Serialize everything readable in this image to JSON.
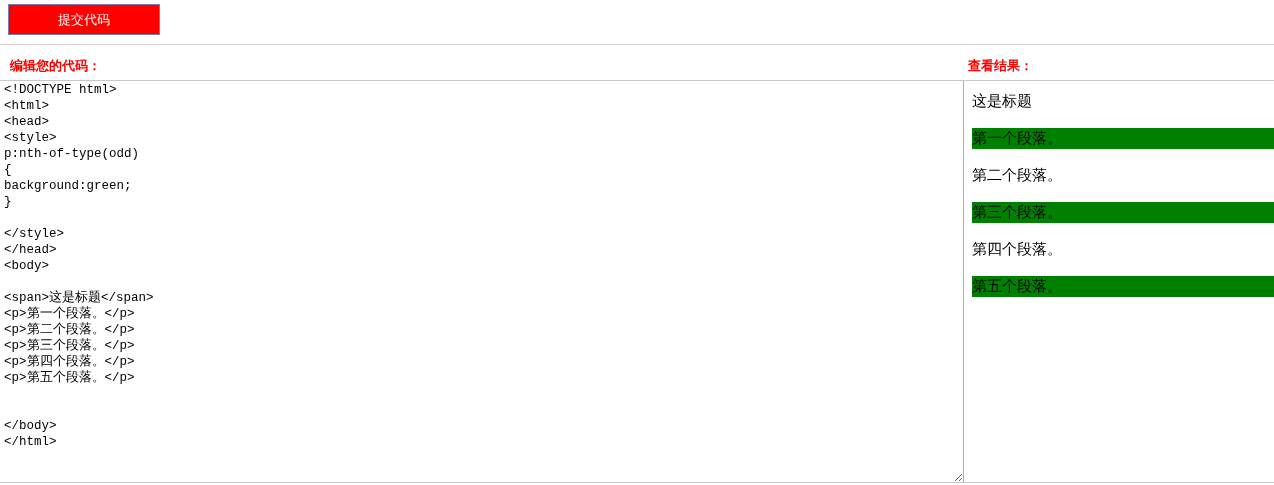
{
  "submit_button": {
    "label": "提交代码"
  },
  "editor": {
    "label": "编辑您的代码：",
    "code": "<!DOCTYPE html>\n<html>\n<head>\n<style>\np:nth-of-type(odd)\n{\nbackground:green;\n}\n\n</style>\n</head>\n<body>\n\n<span>这是标题</span>\n<p>第一个段落。</p>\n<p>第二个段落。</p>\n<p>第三个段落。</p>\n<p>第四个段落。</p>\n<p>第五个段落。</p>\n\n\n</body>\n</html>"
  },
  "result": {
    "label": "查看结果：",
    "title": "这是标题",
    "paragraphs": [
      {
        "text": "第一个段落。",
        "highlighted": true
      },
      {
        "text": "第二个段落。",
        "highlighted": false
      },
      {
        "text": "第三个段落。",
        "highlighted": true
      },
      {
        "text": "第四个段落。",
        "highlighted": false
      },
      {
        "text": "第五个段落。",
        "highlighted": true
      }
    ]
  }
}
